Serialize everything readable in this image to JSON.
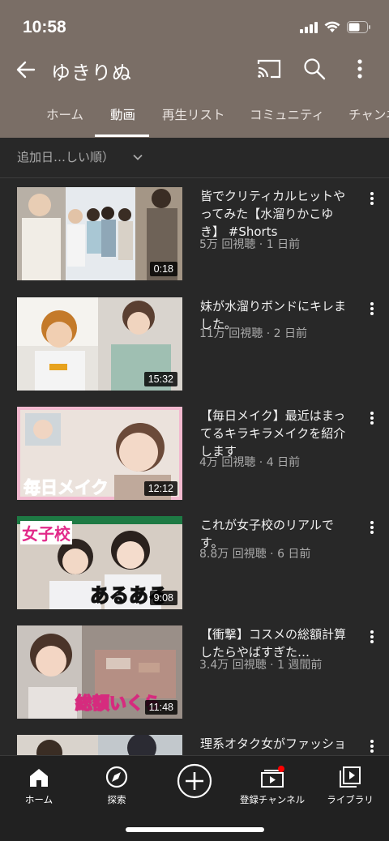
{
  "status_bar": {
    "time": "10:58"
  },
  "appbar": {
    "channel_name": "ゆきりぬ"
  },
  "tabs": [
    {
      "label": "ホーム"
    },
    {
      "label": "動画"
    },
    {
      "label": "再生リスト"
    },
    {
      "label": "コミュニティ"
    },
    {
      "label": "チャンネル"
    }
  ],
  "active_tab": "動画",
  "sort": {
    "label": "追加日…しい順）"
  },
  "videos": [
    {
      "title": "皆でクリティカルヒットやってみた【水溜りかこゆき】 #Shorts",
      "meta": "5万 回視聴 · 1 日前",
      "duration": "0:18"
    },
    {
      "title": "妹が水溜りボンドにキレました。",
      "meta": "11万 回視聴 · 2 日前",
      "duration": "15:32"
    },
    {
      "title": "【毎日メイク】最近はまってるキラキラメイクを紹介します",
      "meta": "4万 回視聴 · 4 日前",
      "duration": "12:12"
    },
    {
      "title": "これが女子校のリアルです。",
      "meta": "8.8万 回視聴 · 6 日前",
      "duration": "9:08"
    },
    {
      "title": "【衝撃】コスメの総額計算したらやばすぎた…",
      "meta": "3.4万 回視聴 · 1 週間前",
      "duration": "11:48"
    },
    {
      "title": "理系オタク女がファッショ",
      "meta": "",
      "duration": ""
    }
  ],
  "thumb_text": {
    "v3": "毎日メイク",
    "v4_top": "女子校",
    "v4_bottom": "あるある",
    "v5": "総額いくら"
  },
  "bottom_nav": [
    {
      "label": "ホーム"
    },
    {
      "label": "探索"
    },
    {
      "label": ""
    },
    {
      "label": "登録チャンネル"
    },
    {
      "label": "ライブラリ"
    }
  ],
  "colors": {
    "header_bg": "#7a6e66",
    "page_bg": "#282828",
    "nav_bg": "#212121",
    "notification_dot": "#ff0000"
  }
}
